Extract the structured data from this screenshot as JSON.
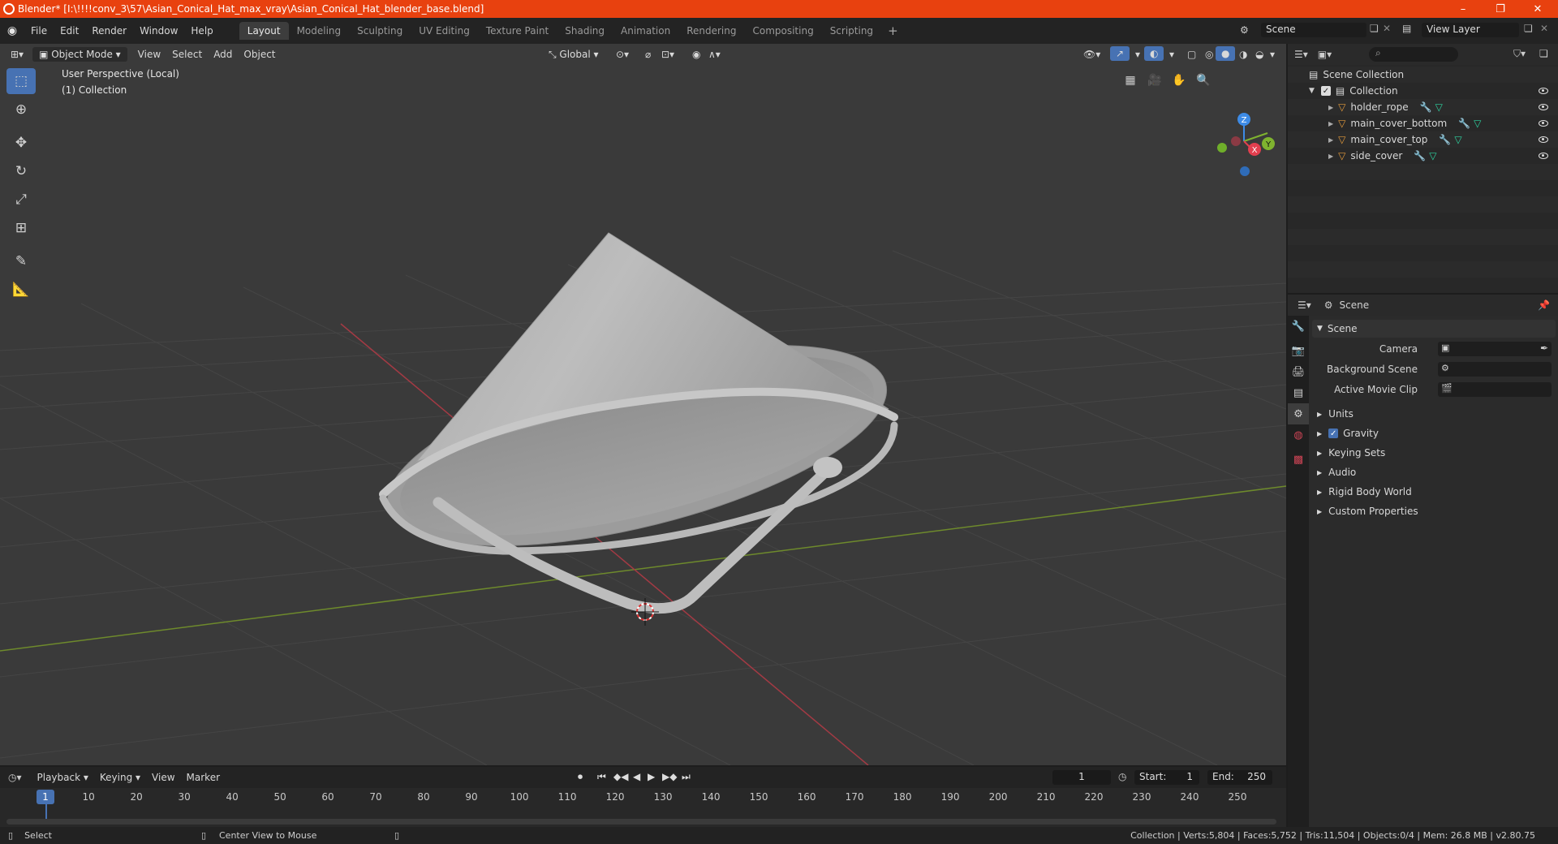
{
  "window": {
    "title": "Blender* [I:\\!!!!conv_3\\57\\Asian_Conical_Hat_max_vray\\Asian_Conical_Hat_blender_base.blend]",
    "minimize": "–",
    "restore": "❐",
    "close": "✕"
  },
  "menu": {
    "items": [
      "File",
      "Edit",
      "Render",
      "Window",
      "Help"
    ],
    "workspaces": [
      "Layout",
      "Modeling",
      "Sculpting",
      "UV Editing",
      "Texture Paint",
      "Shading",
      "Animation",
      "Rendering",
      "Compositing",
      "Scripting"
    ],
    "active_workspace": "Layout",
    "scene_label": "Scene",
    "view_layer_label": "View Layer"
  },
  "viewport": {
    "mode": "Object Mode",
    "menus": [
      "View",
      "Select",
      "Add",
      "Object"
    ],
    "orientation": "Global",
    "overlay_perspective": "User Perspective (Local)",
    "overlay_collection": "(1) Collection",
    "gizmo_axes": {
      "z": "Z",
      "y": "Y",
      "x": "X"
    }
  },
  "outliner": {
    "scene_collection": "Scene Collection",
    "collection": "Collection",
    "objects": [
      "holder_rope",
      "main_cover_bottom",
      "main_cover_top",
      "side_cover"
    ]
  },
  "properties": {
    "header": "Scene",
    "panel_title": "Scene",
    "fields": [
      {
        "label": "Camera"
      },
      {
        "label": "Background Scene"
      },
      {
        "label": "Active Movie Clip"
      }
    ],
    "sections": [
      "Units",
      "Gravity",
      "Keying Sets",
      "Audio",
      "Rigid Body World",
      "Custom Properties"
    ],
    "gravity_checked": true
  },
  "timeline": {
    "menus": [
      "Playback",
      "Keying",
      "View",
      "Marker"
    ],
    "current_frame": "1",
    "start_label": "Start:",
    "start": "1",
    "end_label": "End:",
    "end": "250",
    "ruler": [
      "1",
      "10",
      "20",
      "30",
      "40",
      "50",
      "60",
      "70",
      "80",
      "90",
      "100",
      "110",
      "120",
      "130",
      "140",
      "150",
      "160",
      "170",
      "180",
      "190",
      "200",
      "210",
      "220",
      "230",
      "240",
      "250"
    ]
  },
  "statusbar": {
    "left_action": "Select",
    "middle_action": "Center View to Mouse",
    "stats": "Collection | Verts:5,804 | Faces:5,752 | Tris:11,504 | Objects:0/4 | Mem: 26.8 MB | v2.80.75"
  },
  "colors": {
    "accent": "#4772b3",
    "titlebar": "#e8410f",
    "axis_x": "#e23f4f",
    "axis_y": "#7fb32f",
    "axis_z": "#3d8be6",
    "mesh_icon": "#e39a3b",
    "modifier_icon": "#5f9fe0",
    "data_icon": "#2ed3a0"
  }
}
